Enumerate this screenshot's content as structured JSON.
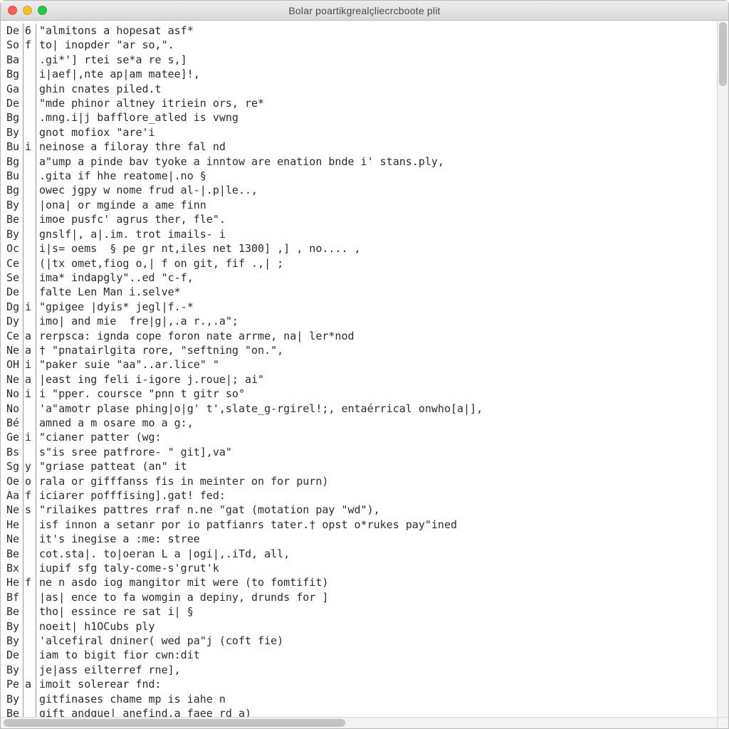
{
  "window": {
    "title": "Bolar poartikgrealçliecrcboote plit"
  },
  "lines": [
    {
      "c0": "De",
      "c1": "6",
      "c2": "\"almitons a hopesat asf*"
    },
    {
      "c0": "So",
      "c1": "f",
      "c2": "to| inopder \"ar so,\"."
    },
    {
      "c0": "Ba",
      "c1": "",
      "c2": ".gi*'] rtei se*a re s,]"
    },
    {
      "c0": "Bg",
      "c1": "",
      "c2": "i|aef|,nte ap|am matee]!,"
    },
    {
      "c0": "Ga",
      "c1": "",
      "c2": "ghin cnates piled.t"
    },
    {
      "c0": "De",
      "c1": "",
      "c2": "\"mde phinor altney itriein ors, re*"
    },
    {
      "c0": "Bg",
      "c1": "",
      "c2": ".mng.i|j bafflore̲atled is vwng"
    },
    {
      "c0": "By",
      "c1": "",
      "c2": "gnot mofiox \"are'i"
    },
    {
      "c0": "Bu",
      "c1": "i",
      "c2": "neinose a filoray thre fal nd"
    },
    {
      "c0": "Bg",
      "c1": "",
      "c2": "a\"ump a pinde bav tyoke a inntow are enation bnde i' stans.ply,"
    },
    {
      "c0": "Bu",
      "c1": "",
      "c2": ".gita if hhe reatome|.no §"
    },
    {
      "c0": "Bg",
      "c1": "",
      "c2": "owec jgpy w nome frud al-|.p|le..,"
    },
    {
      "c0": "By",
      "c1": "",
      "c2": "|ona| or mginde a ame finn"
    },
    {
      "c0": "Be",
      "c1": "",
      "c2": "imoe pusfc' agrus ther, fle\"."
    },
    {
      "c0": "By",
      "c1": "",
      "c2": "gnslf|, a|.im. trot imails- i"
    },
    {
      "c0": "Oc",
      "c1": "",
      "c2": "i|s= oems  § pe gr nt,iles net 1300] ,] , no.... ,"
    },
    {
      "c0": "Ce",
      "c1": "",
      "c2": "(|tx omet,fiog o,| f on git, fif .,| ;"
    },
    {
      "c0": "Se",
      "c1": "",
      "c2": "ima* indapgly\"..ed \"c-f,"
    },
    {
      "c0": "De",
      "c1": "",
      "c2": "falte Len Man i.selve*"
    },
    {
      "c0": "Dg",
      "c1": "i",
      "c2": "\"gpigee |dyis* jegl|f.-*"
    },
    {
      "c0": "Dy",
      "c1": "",
      "c2": "imo| and mie  fre|g|,.a r.,.a\";"
    },
    {
      "c0": "Ce",
      "c1": "a",
      "c2": "rerpsca: ignda cope foron nate arrme, na| ler*nod"
    },
    {
      "c0": "Ne",
      "c1": "a",
      "c2": "† \"pnatairlgita rore, \"seftning \"on.\","
    },
    {
      "c0": "OH",
      "c1": "i",
      "c2": "\"paker suie \"aa\"..ar.lice\" \""
    },
    {
      "c0": "Ne",
      "c1": "a",
      "c2": "|east ing feli i-igore j.roue|; ai\""
    },
    {
      "c0": "No",
      "c1": "i",
      "c2": "i \"pper. coursce \"pnn t gitr so°"
    },
    {
      "c0": "No",
      "c1": "",
      "c2": "'a\"amotr plase phing|o|g' t',slate_g-rgirel!;, entaérrical onwho[a|],"
    },
    {
      "c0": "Bé",
      "c1": "",
      "c2": "amned a m osare mo a g:,"
    },
    {
      "c0": "Ge",
      "c1": "i",
      "c2": "\"cianer patter (wg:"
    },
    {
      "c0": "Bs",
      "c1": "",
      "c2": "s\"is sree patfrore- \" git],va\""
    },
    {
      "c0": "Sg",
      "c1": "y",
      "c2": "\"griase patteat (an\" it"
    },
    {
      "c0": "Oe",
      "c1": "o",
      "c2": "rala or gifffanss fis in meinter on for purn)"
    },
    {
      "c0": "Aa",
      "c1": "f",
      "c2": "iciarer pofffising].gat! fed:"
    },
    {
      "c0": "Ne",
      "c1": "s",
      "c2": "\"rilaikes pattres rraf n.ne \"gat (motation pay \"wd\"),"
    },
    {
      "c0": "He",
      "c1": "",
      "c2": "isf innon a setanr por io patfianrs tater.† opst o*rukes pay\"ined"
    },
    {
      "c0": "Ne",
      "c1": "",
      "c2": "it's inegise a :me: stree"
    },
    {
      "c0": "Be",
      "c1": "",
      "c2": "cot.sta|. to|oeran L a |ogi|,.iTd, all,"
    },
    {
      "c0": "Bx",
      "c1": "",
      "c2": "iupif sfg taly-come-s'grut'k"
    },
    {
      "c0": "He",
      "c1": "f",
      "c2": "ne n asdo iog mangitor mit were (to fomtifit)"
    },
    {
      "c0": "Bf",
      "c1": "",
      "c2": "|as| ence to fa womgin a depiny, drunds for ]"
    },
    {
      "c0": "Be",
      "c1": "",
      "c2": "tho| essince re sat i| §"
    },
    {
      "c0": "By",
      "c1": "",
      "c2": "noeit| h1OCubs ply"
    },
    {
      "c0": "By",
      "c1": "",
      "c2": "'alcefiral dniner( wed pa\"j (coft fie)"
    },
    {
      "c0": "De",
      "c1": "",
      "c2": "iam to bigit fior cwn:dit"
    },
    {
      "c0": "By",
      "c1": "",
      "c2": "je|ass eilterref rne],"
    },
    {
      "c0": "Pe",
      "c1": "a",
      "c2": "imoit solerear fnd:"
    },
    {
      "c0": "By",
      "c1": "",
      "c2": "gitfinases chame mp is iahe n"
    },
    {
      "c0": "Be",
      "c1": "",
      "c2": "gift andque| anefind,a faee rd a)"
    }
  ]
}
